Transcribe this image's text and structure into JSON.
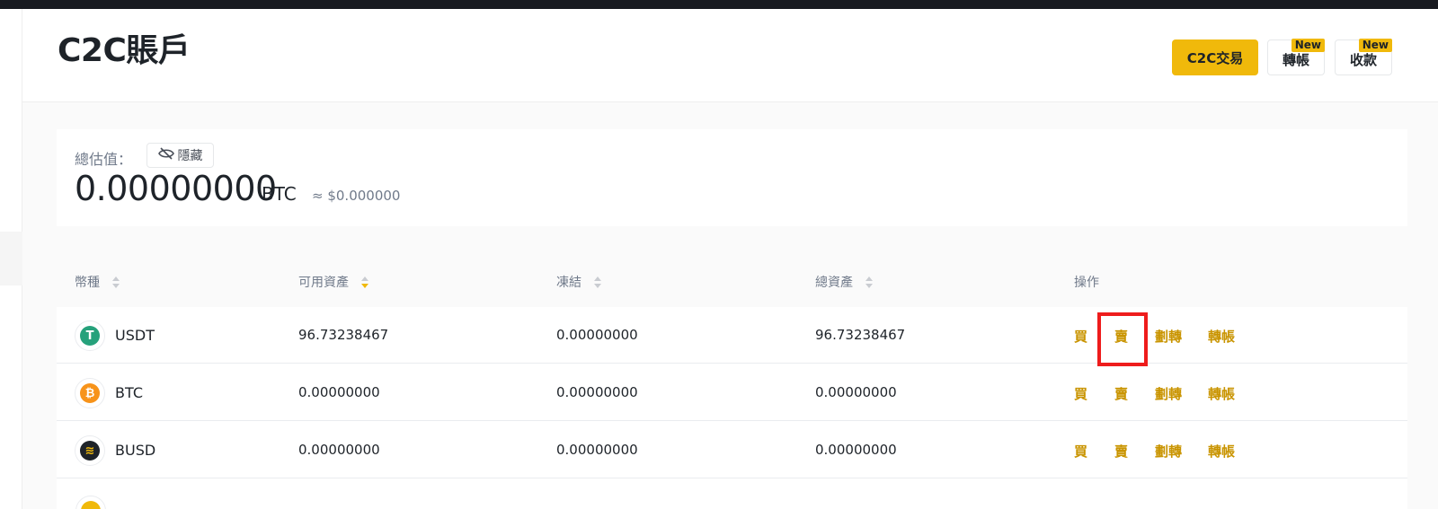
{
  "page": {
    "title": "C2C賬戶"
  },
  "header_buttons": {
    "c2c_trade": "C2C交易",
    "transfer": "轉帳",
    "receive": "收款",
    "new_badge": "New"
  },
  "summary": {
    "label": "總估值：",
    "hide_label": "隱藏",
    "value": "0.00000000",
    "unit": "BTC",
    "fiat": "≈ $0.000000"
  },
  "table": {
    "headers": [
      "幣種",
      "可用資產",
      "凍結",
      "總資產",
      "操作"
    ],
    "rows": [
      {
        "coin": "USDT",
        "available": "96.73238467",
        "frozen": "0.00000000",
        "total": "96.73238467"
      },
      {
        "coin": "BTC",
        "available": "0.00000000",
        "frozen": "0.00000000",
        "total": "0.00000000"
      },
      {
        "coin": "BUSD",
        "available": "0.00000000",
        "frozen": "0.00000000",
        "total": "0.00000000"
      }
    ],
    "actions": {
      "buy": "買",
      "sell": "賣",
      "move": "劃轉",
      "transfer": "轉帳"
    }
  },
  "colors": {
    "accent": "#f0b90b",
    "action_text": "#c99400",
    "highlight_box": "#ee1c1c",
    "usdt": "#26a17b",
    "btc": "#f7931a",
    "busd": "#1e2329"
  }
}
